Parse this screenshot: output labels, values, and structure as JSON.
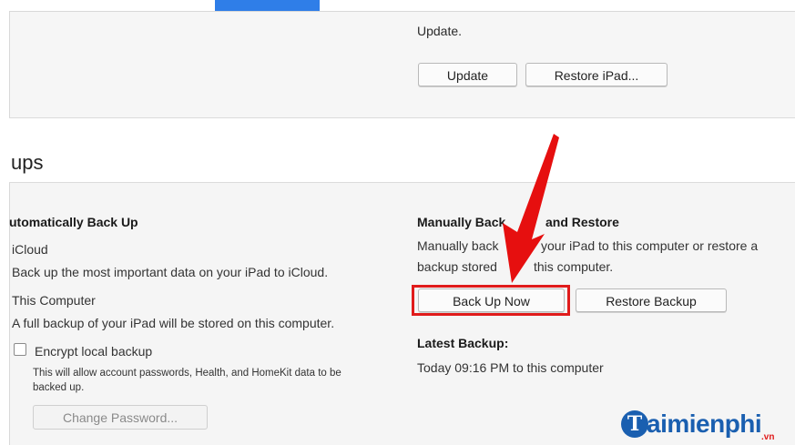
{
  "top": {
    "update_text": "Update.",
    "update_button": "Update",
    "restore_ipad_button": "Restore iPad..."
  },
  "backups": {
    "title": "ups",
    "auto": {
      "heading": "utomatically Back Up",
      "icloud_label": "iCloud",
      "icloud_desc": "Back up the most important data on your iPad to iCloud.",
      "computer_label": "This Computer",
      "computer_desc": "A full backup of your iPad will be stored on this computer.",
      "encrypt_label": "Encrypt local backup",
      "encrypt_desc_line1": "This will allow account passwords, Health, and HomeKit data to be",
      "encrypt_desc_line2": "backed up.",
      "change_password_button": "Change Password..."
    },
    "manual": {
      "heading_part1": "Manually Back",
      "heading_part2": "and Restore",
      "desc_line1_part1": "Manually back",
      "desc_line1_part2": "your iPad to this computer or restore a",
      "desc_line2_part1": "backup stored",
      "desc_line2_part2": "this computer.",
      "back_up_now_button": "Back Up Now",
      "restore_backup_button": "Restore Backup",
      "latest_backup_heading": "Latest Backup:",
      "latest_backup_value": "Today 09:16 PM to this computer"
    }
  },
  "watermark": {
    "logo_letter": "T",
    "logo_text": "aimienphi",
    "logo_suffix": ".vn"
  },
  "colors": {
    "accent_blue": "#2f7ee8",
    "highlight_red": "#e01b1b",
    "logo_blue": "#1a5fb0"
  }
}
